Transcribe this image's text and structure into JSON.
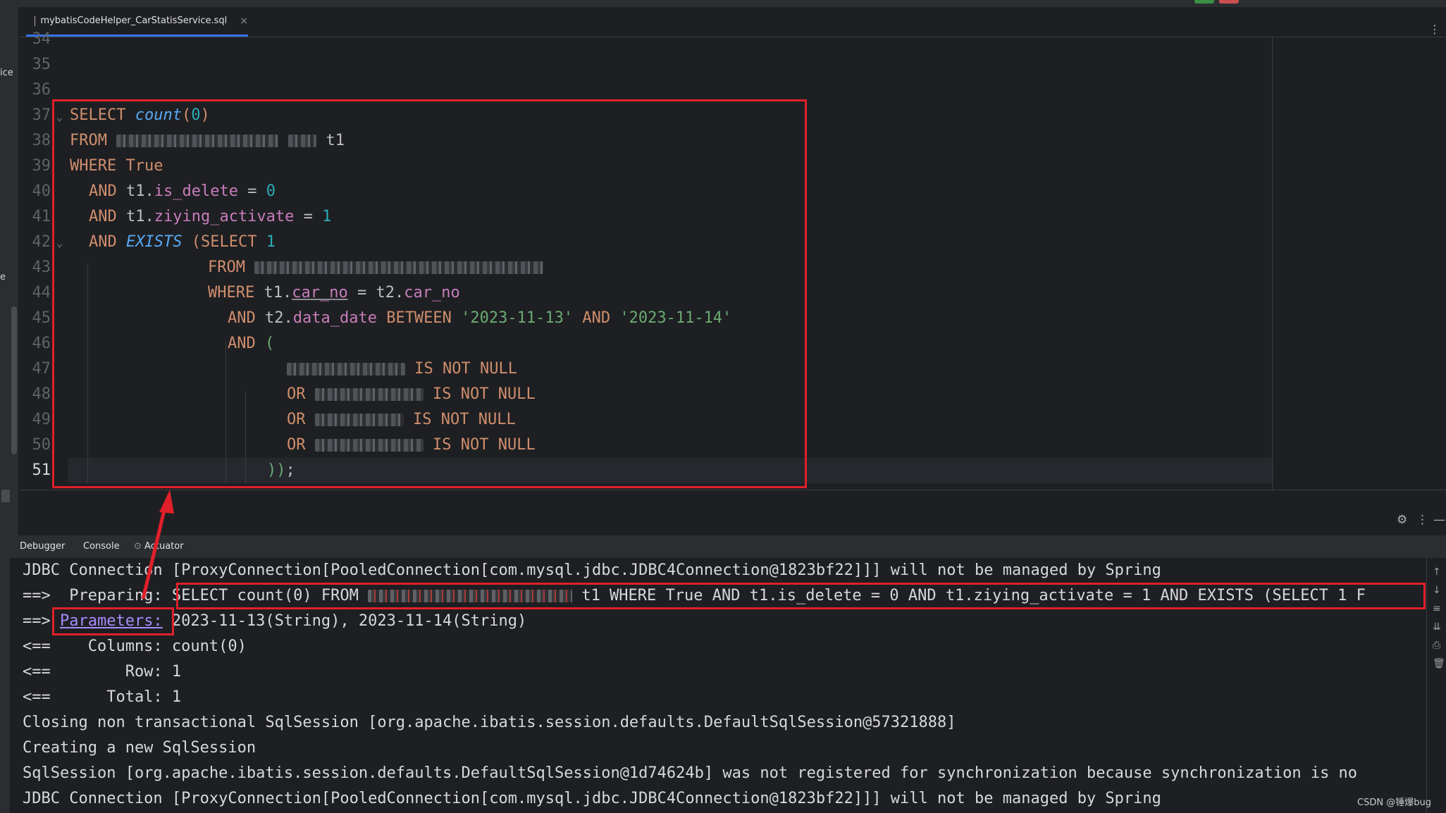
{
  "window": {
    "tab_title": "mybatisCodeHelper_CarStatisService.sql",
    "tab_close": "×",
    "more": "⋮",
    "left_fragments": [
      "ice",
      "e"
    ]
  },
  "editor": {
    "line_numbers": [
      "34",
      "35",
      "36",
      "37",
      "38",
      "39",
      "40",
      "41",
      "42",
      "43",
      "44",
      "45",
      "46",
      "47",
      "48",
      "49",
      "50",
      "51"
    ],
    "lines": {
      "l37": {
        "kw1": "SELECT ",
        "fn": "count",
        "p1": "(",
        "n": "0",
        "p2": ")"
      },
      "l38": {
        "kw": "FROM ",
        "tail": " t1"
      },
      "l39": {
        "kw": "WHERE True"
      },
      "l40": {
        "kw": "AND ",
        "t": "t1.",
        "f": "is_delete",
        "op": " = ",
        "n": "0"
      },
      "l41": {
        "kw": "AND ",
        "t": "t1.",
        "f": "ziying_activate",
        "op": " = ",
        "n": "1"
      },
      "l42": {
        "kw": "AND ",
        "fn": "EXISTS",
        "sp": " ",
        "p": "(",
        "kw2": "SELECT ",
        "n": "1"
      },
      "l43": {
        "kw": "FROM "
      },
      "l44": {
        "kw": "WHERE ",
        "t1": "t1.",
        "f1": "car_no",
        "op": " = ",
        "t2": "t2.",
        "f2": "car_no"
      },
      "l45": {
        "kw": "AND ",
        "t": "t2.",
        "f": "data_date",
        "kw2": " BETWEEN ",
        "s1": "'2023-11-13'",
        "kw3": " AND ",
        "s2": "'2023-11-14'"
      },
      "l46": {
        "kw": "AND ",
        "p": "("
      },
      "l47": {
        "tail": " IS NOT NULL"
      },
      "l48": {
        "kw": "OR ",
        "tail": " IS NOT NULL"
      },
      "l49": {
        "kw": "OR ",
        "tail": " IS NOT NULL"
      },
      "l50": {
        "kw": "OR ",
        "tail": " IS NOT NULL"
      },
      "l51": {
        "p": "))",
        "semi": ";"
      }
    }
  },
  "tool_window": {
    "tabs": [
      "Debugger",
      "Console",
      "Actuator"
    ],
    "settings_icon": "⚙",
    "more": "⋮",
    "minimize": "—"
  },
  "console": {
    "line1": "JDBC Connection [ProxyConnection[PooledConnection[com.mysql.jdbc.JDBC4Connection@1823bf22]]] will not be managed by Spring",
    "line2_prefix": "==>  Preparing: ",
    "line2_sql_a": "SELECT count(0) FROM ",
    "line2_sql_b": " t1 WHERE True AND t1.is_delete = 0 AND t1.ziying_activate = 1 AND EXISTS (SELECT 1 F",
    "line3_prefix": "==> ",
    "line3_link": "Parameters:",
    "line3_rest": " 2023-11-13(String), 2023-11-14(String)",
    "line4": "<==    Columns: count(0)",
    "line5": "<==        Row: 1",
    "line6": "<==      Total: 1",
    "line7": "Closing non transactional SqlSession [org.apache.ibatis.session.defaults.DefaultSqlSession@57321888]",
    "line8": "Creating a new SqlSession",
    "line9": "SqlSession [org.apache.ibatis.session.defaults.DefaultSqlSession@1d74624b] was not registered for synchronization because synchronization is no",
    "line10": "JDBC Connection [ProxyConnection[PooledConnection[com.mysql.jdbc.JDBC4Connection@1823bf22]]] will not be managed by Spring"
  },
  "watermark": "CSDN @锤爆bug",
  "colors": {
    "highlight_box": "#e0202a",
    "keyword": "#cf8e6d",
    "function": "#56a8f5",
    "number": "#2aacb8",
    "string": "#6aab73",
    "field": "#c77dbb"
  }
}
